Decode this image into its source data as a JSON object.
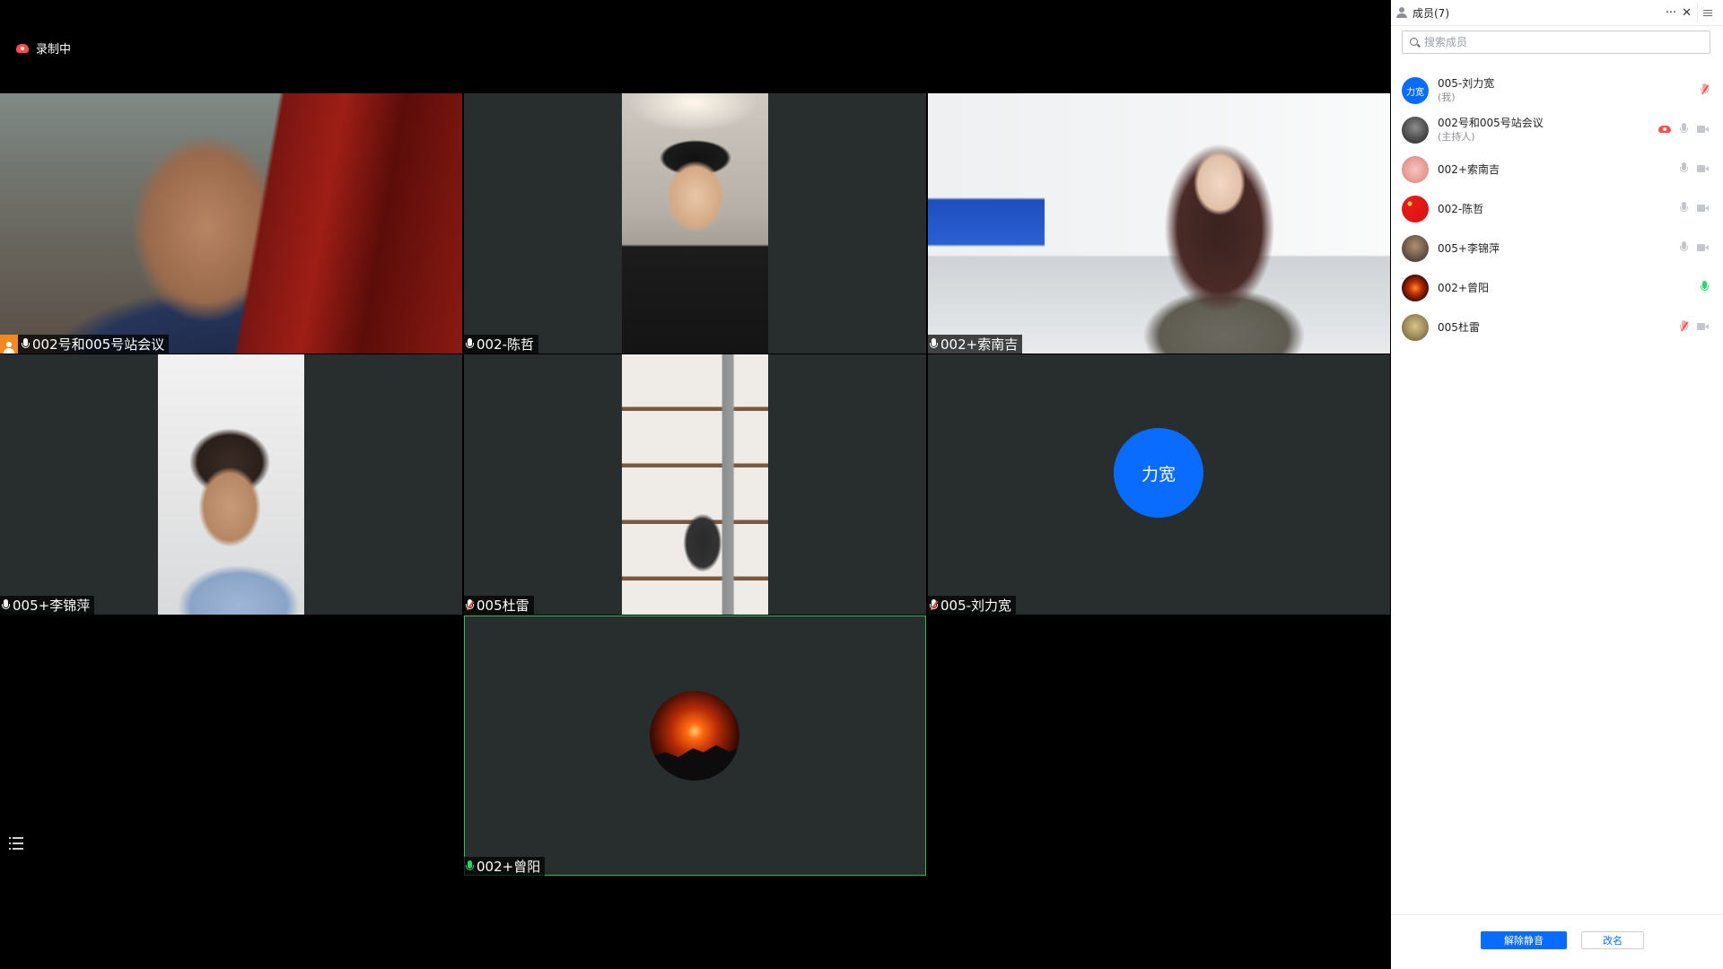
{
  "recording": {
    "label": "录制中"
  },
  "tiles": [
    {
      "name": "002号和005号站会议",
      "is_host": true,
      "mic": "on"
    },
    {
      "name": "002-陈哲",
      "mic": "on"
    },
    {
      "name": "002+索南吉",
      "mic": "on"
    },
    {
      "name": "005+李锦萍",
      "mic": "on"
    },
    {
      "name": "005杜雷",
      "mic": "muted"
    },
    {
      "name": "005-刘力宽",
      "mic": "muted",
      "avatar_text": "力宽"
    },
    {
      "name": "002+曾阳",
      "mic": "speaking",
      "active": true
    }
  ],
  "panel": {
    "title": "成员(7)",
    "more": "···",
    "close": "✕",
    "search_placeholder": "搜索成员",
    "members": [
      {
        "name": "005-刘力宽",
        "sub": "(我)",
        "avatar_text": "力宽",
        "mic": "muted"
      },
      {
        "name": "002号和005号站会议",
        "sub": "(主持人)",
        "mic": "off",
        "recording": true
      },
      {
        "name": "002+索南吉",
        "mic": "off"
      },
      {
        "name": "002-陈哲",
        "mic": "off"
      },
      {
        "name": "005+李锦萍",
        "mic": "off"
      },
      {
        "name": "002+曾阳",
        "mic": "speaking"
      },
      {
        "name": "005杜雷",
        "mic": "muted"
      }
    ],
    "unmute_label": "解除静音",
    "rename_label": "改名"
  },
  "colors": {
    "accent": "#0a6cff",
    "tile_bg": "#282e2d",
    "speaking": "#2dd36f",
    "host": "#f08a24",
    "rec": "#ff4d4f"
  }
}
